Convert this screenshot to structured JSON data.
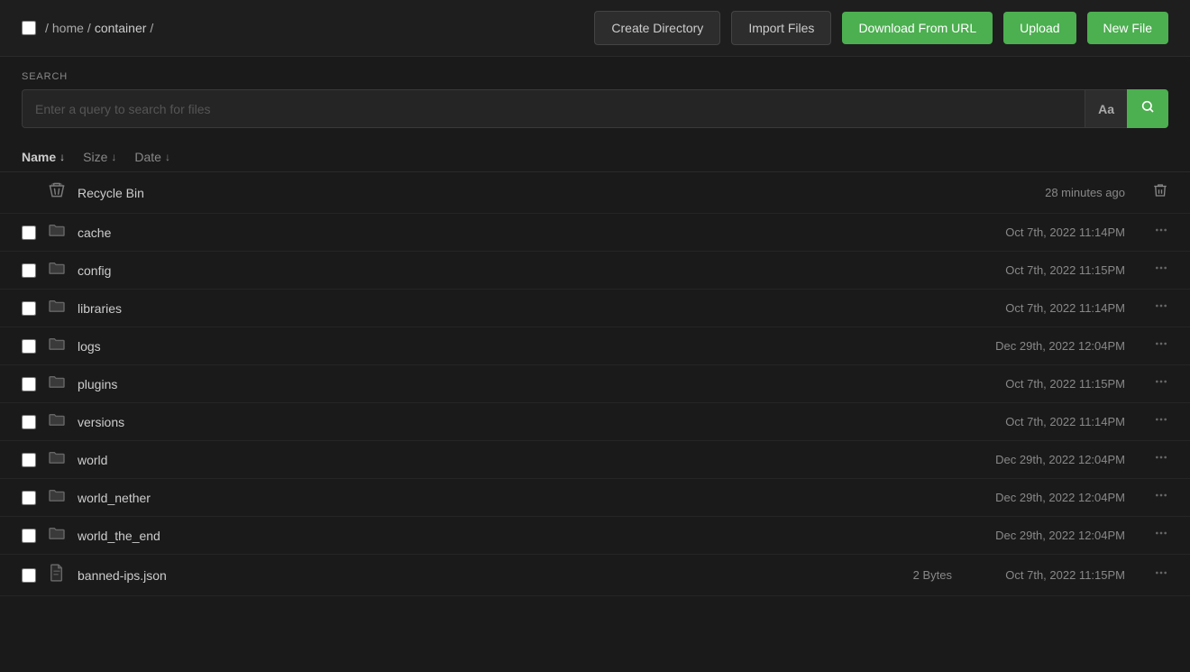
{
  "header": {
    "checkbox_label": "select-all",
    "breadcrumb": [
      "home",
      "container"
    ],
    "breadcrumb_separator": "/",
    "buttons": {
      "create_directory": "Create Directory",
      "import_files": "Import Files",
      "download_from_url": "Download From URL",
      "upload": "Upload",
      "new_file": "New File"
    }
  },
  "search": {
    "label": "SEARCH",
    "placeholder": "Enter a query to search for files",
    "case_btn": "Aa",
    "search_icon": "🔍"
  },
  "sort": {
    "name_label": "Name",
    "size_label": "Size",
    "date_label": "Date",
    "arrow": "↓"
  },
  "recycle_bin": {
    "name": "Recycle Bin",
    "date": "28 minutes ago"
  },
  "files": [
    {
      "type": "folder",
      "name": "cache",
      "size": "",
      "date": "Oct 7th, 2022 11:14PM"
    },
    {
      "type": "folder",
      "name": "config",
      "size": "",
      "date": "Oct 7th, 2022 11:15PM"
    },
    {
      "type": "folder",
      "name": "libraries",
      "size": "",
      "date": "Oct 7th, 2022 11:14PM"
    },
    {
      "type": "folder",
      "name": "logs",
      "size": "",
      "date": "Dec 29th, 2022 12:04PM"
    },
    {
      "type": "folder",
      "name": "plugins",
      "size": "",
      "date": "Oct 7th, 2022 11:15PM"
    },
    {
      "type": "folder",
      "name": "versions",
      "size": "",
      "date": "Oct 7th, 2022 11:14PM"
    },
    {
      "type": "folder",
      "name": "world",
      "size": "",
      "date": "Dec 29th, 2022 12:04PM"
    },
    {
      "type": "folder",
      "name": "world_nether",
      "size": "",
      "date": "Dec 29th, 2022 12:04PM"
    },
    {
      "type": "folder",
      "name": "world_the_end",
      "size": "",
      "date": "Dec 29th, 2022 12:04PM"
    },
    {
      "type": "file",
      "name": "banned-ips.json",
      "size": "2 Bytes",
      "date": "Oct 7th, 2022 11:15PM"
    }
  ]
}
